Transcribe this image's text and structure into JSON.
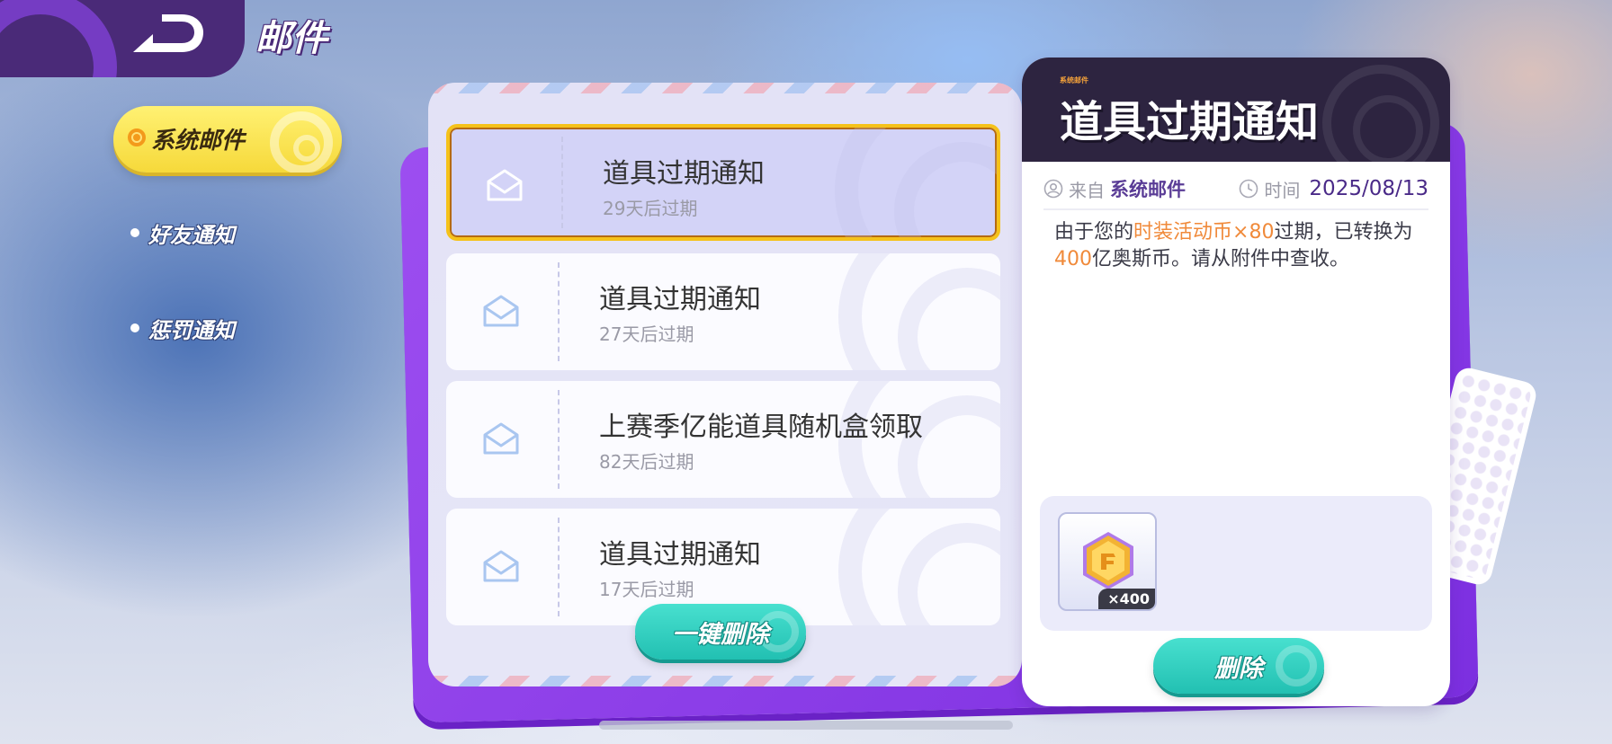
{
  "header": {
    "title": "邮件"
  },
  "sidebar": {
    "tabs": [
      {
        "label": "系统邮件",
        "active": true
      },
      {
        "label": "好友通知",
        "active": false
      },
      {
        "label": "惩罚通知",
        "active": false
      }
    ]
  },
  "mail_list": {
    "items": [
      {
        "title": "道具过期通知",
        "expire": "29天后过期",
        "selected": true
      },
      {
        "title": "道具过期通知",
        "expire": "27天后过期",
        "selected": false
      },
      {
        "title": "上赛季亿能道具随机盒领取",
        "expire": "82天后过期",
        "selected": false
      },
      {
        "title": "道具过期通知",
        "expire": "17天后过期",
        "selected": false
      }
    ],
    "delete_all_label": "一键删除"
  },
  "detail": {
    "tag": "系统邮件",
    "title": "道具过期通知",
    "from_label": "来自",
    "from_value": "系统邮件",
    "time_label": "时间",
    "time_value": "2025/08/13",
    "body": {
      "part1": "由于您的",
      "highlight1": "时装活动币×80",
      "part2": "过期，已转换为",
      "highlight2": "400",
      "part3": "亿奥斯币。请从附件中查收。"
    },
    "attachment": {
      "icon": "coin-icon",
      "quantity": "×400"
    },
    "delete_label": "删除"
  },
  "colors": {
    "accent_purple": "#4a2a78",
    "active_tab": "#f6d93a",
    "highlight_orange": "#f08a3a",
    "teal_button": "#22c0b2"
  }
}
